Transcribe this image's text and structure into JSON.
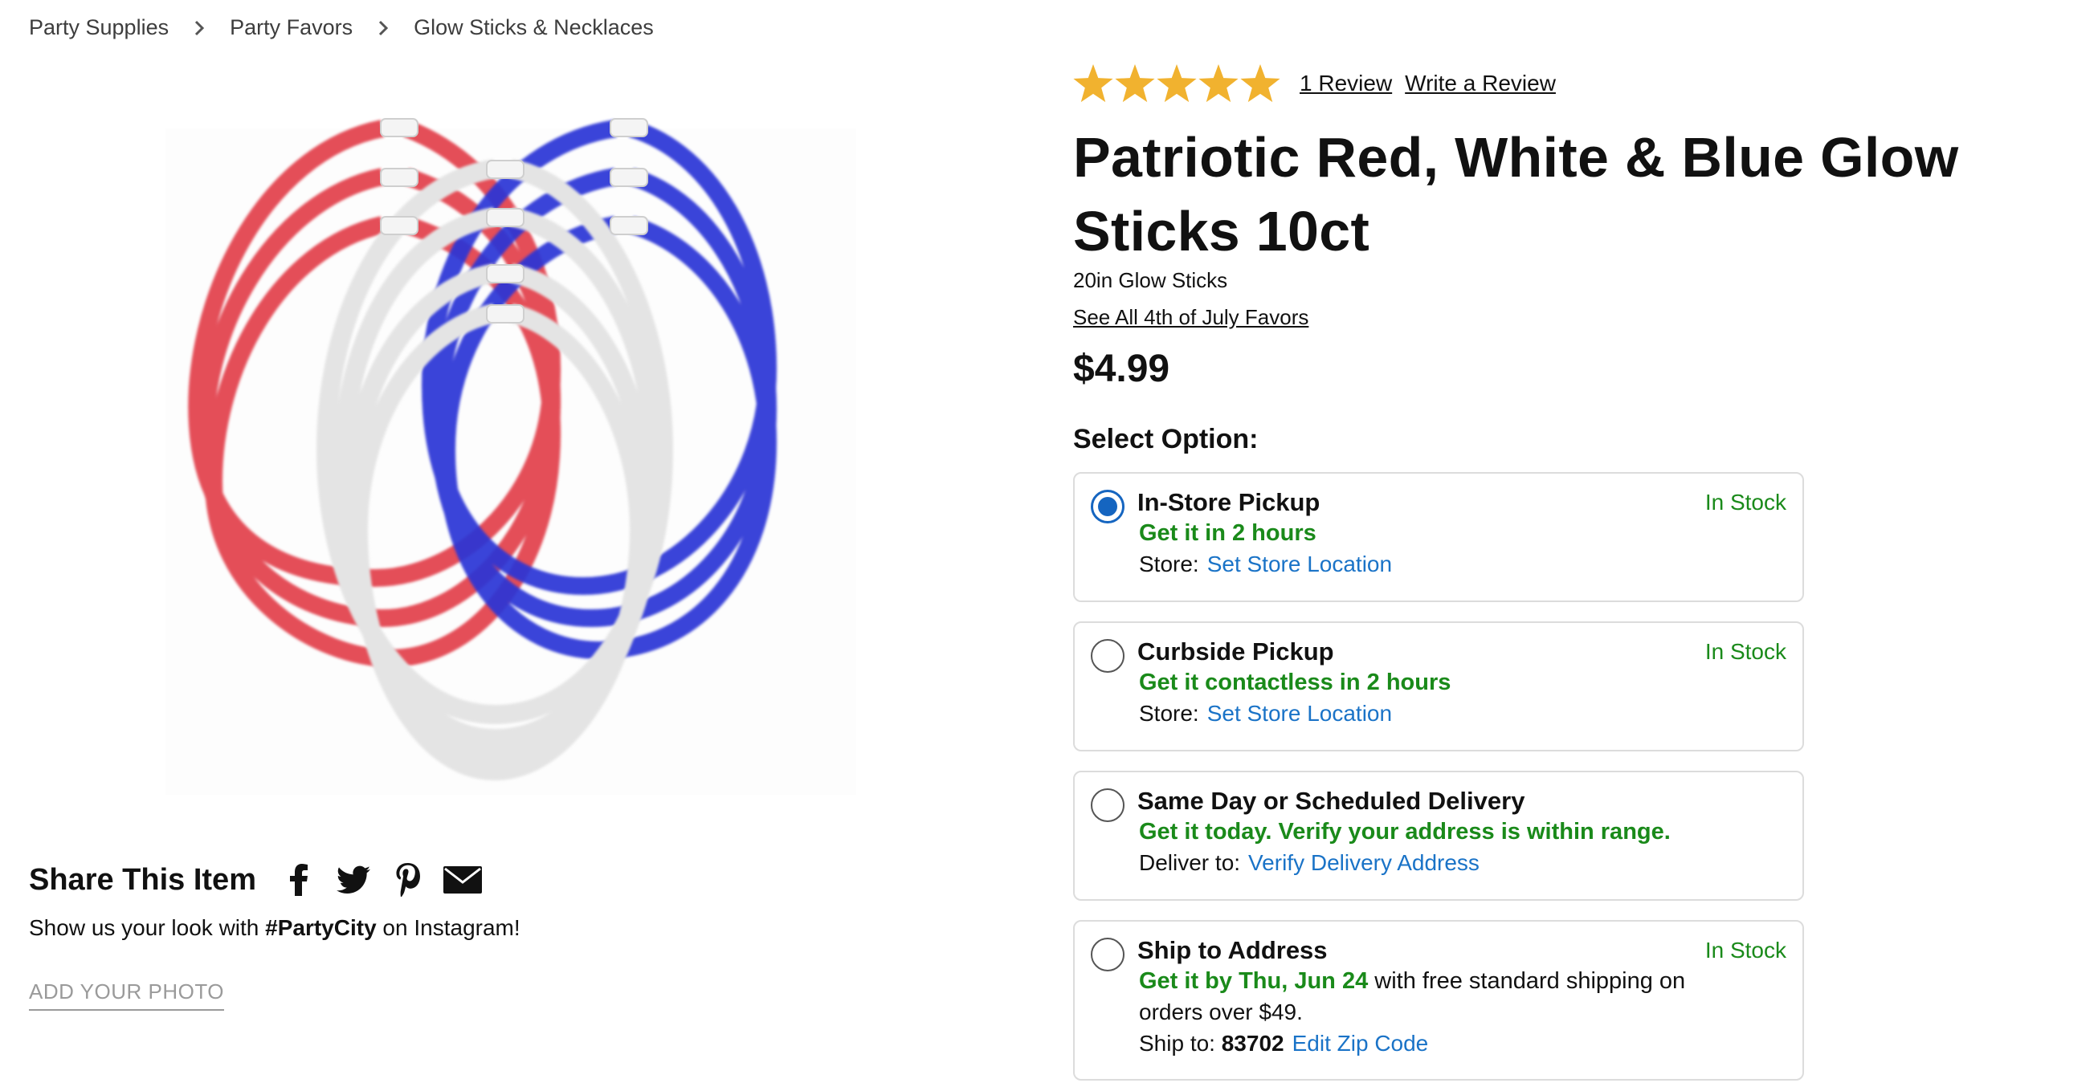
{
  "breadcrumb": {
    "items": [
      "Party Supplies",
      "Party Favors",
      "Glow Sticks & Necklaces"
    ]
  },
  "product": {
    "image_alt": "Patriotic red, white and blue glow stick necklaces",
    "rating": {
      "value": 5,
      "max": 5
    },
    "review_count_label": "1 Review",
    "write_review_label": "Write a Review",
    "title": "Patriotic Red, White & Blue Glow Sticks 10ct",
    "subtitle": "20in Glow Sticks",
    "see_all_link": "See All 4th of July Favors",
    "price": "$4.99"
  },
  "share": {
    "title": "Share This Item",
    "icons": [
      "facebook-icon",
      "twitter-icon",
      "pinterest-icon",
      "email-icon"
    ],
    "instagram_prefix": "Show us your look with ",
    "instagram_tag": "#PartyCity",
    "instagram_suffix": " on Instagram!",
    "add_photo_label": "ADD YOUR PHOTO"
  },
  "options": {
    "label": "Select Option:",
    "selected": "in_store",
    "items": [
      {
        "id": "in_store",
        "title": "In-Store Pickup",
        "stock": "In Stock",
        "green_text": "Get it in 2 hours",
        "detail_label": "Store:",
        "detail_link": "Set Store Location"
      },
      {
        "id": "curbside",
        "title": "Curbside Pickup",
        "stock": "In Stock",
        "green_text": "Get it contactless in 2 hours",
        "detail_label": "Store:",
        "detail_link": "Set Store Location"
      },
      {
        "id": "same_day",
        "title": "Same Day or Scheduled Delivery",
        "stock": "",
        "green_text": "Get it today. Verify your address is within range.",
        "detail_label": "Deliver to:",
        "detail_link": "Verify Delivery Address"
      },
      {
        "id": "ship",
        "title": "Ship to Address",
        "stock": "In Stock",
        "green_text": "Get it by Thu, Jun 24",
        "green_suffix": " with free standard shipping on",
        "line3": "orders over $49.",
        "detail_label": "Ship to:",
        "detail_value": "83702",
        "detail_link": "Edit Zip Code"
      }
    ]
  },
  "colors": {
    "star": "#f1b22f",
    "in_stock_green": "#1a8a1a",
    "link_blue": "#1a73c7",
    "radio_selected": "#1565c0",
    "glow_red": "#e2404b",
    "glow_blue": "#2c34d6",
    "glow_white": "#e6e6e6"
  }
}
